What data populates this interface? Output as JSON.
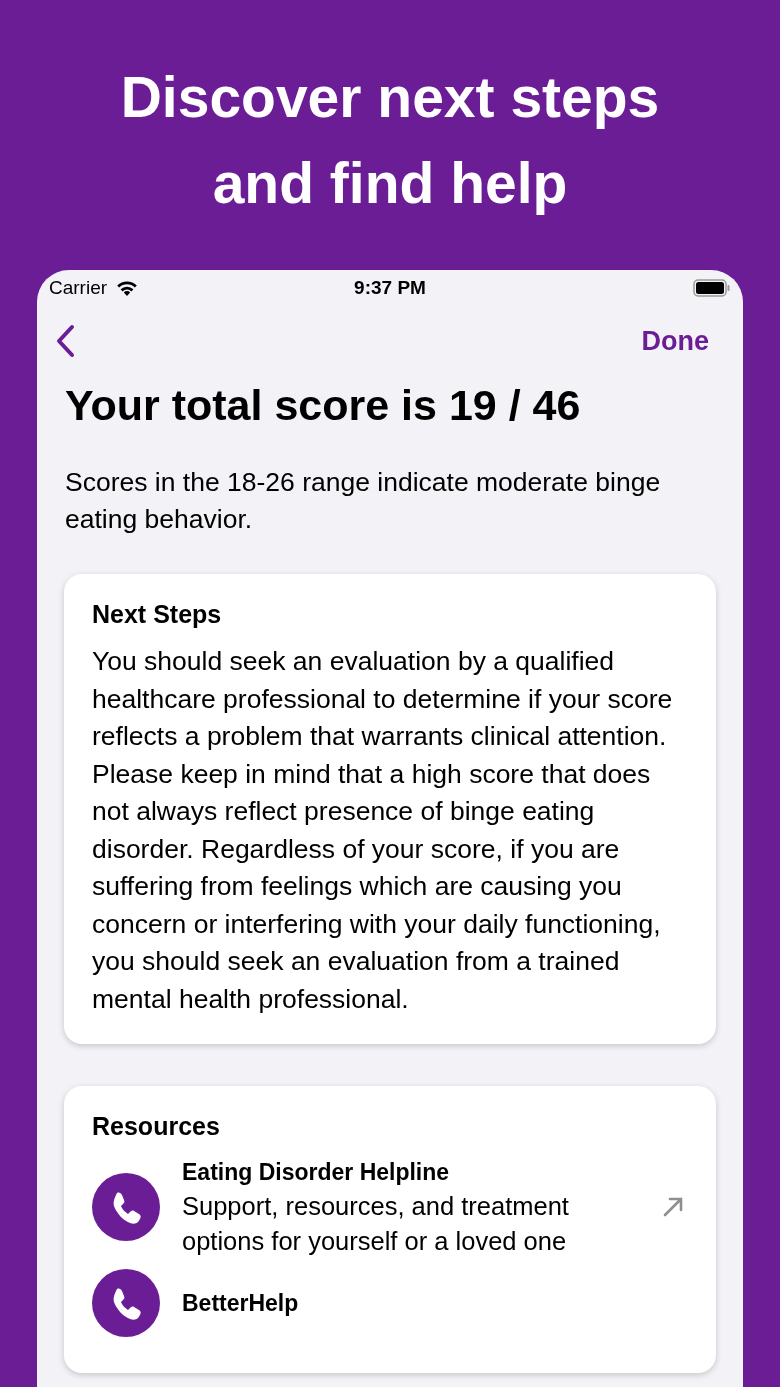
{
  "headline": "Discover next steps and find help",
  "status_bar": {
    "carrier": "Carrier",
    "time": "9:37 PM"
  },
  "nav": {
    "done": "Done"
  },
  "title": "Your total score is 19 / 46",
  "summary": "Scores in the 18-26 range indicate moderate binge eating behavior.",
  "next_steps": {
    "heading": "Next Steps",
    "body": "You should seek an evaluation by a qualified healthcare professional to determine if your score reflects a problem that warrants clinical attention. Please keep in mind that a high score that does not always reflect presence of binge eating disorder. Regardless of your score, if you are suffering from feelings which are causing you concern or interfering with your daily functioning, you should seek an evaluation from a trained mental health professional."
  },
  "resources": {
    "heading": "Resources",
    "items": [
      {
        "title": "Eating Disorder Helpline",
        "description": "Support, resources, and treatment options for yourself or a loved one"
      },
      {
        "title": "BetterHelp"
      }
    ]
  }
}
